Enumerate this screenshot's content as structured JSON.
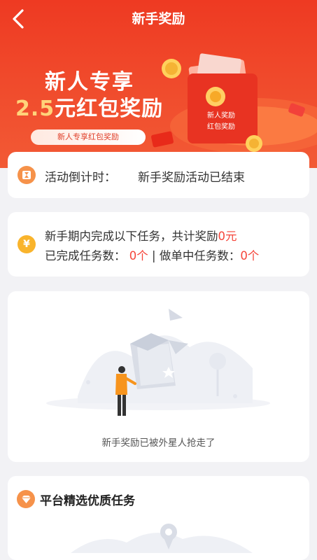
{
  "nav": {
    "title": "新手奖励",
    "back_icon": "chevron-left-icon"
  },
  "banner": {
    "line1": "新人专享",
    "amount": "2.5",
    "line2_suffix": "元红包奖励",
    "pill": "新人专享红包奖励",
    "envelope_line1": "新人奖励",
    "envelope_line2": "红包奖励",
    "colors": {
      "background": "#ee3a22",
      "accent": "#ffd37a"
    }
  },
  "countdown": {
    "label": "活动倒计时：",
    "status": "新手奖励活动已结束",
    "icon": "hourglass-icon"
  },
  "tasks": {
    "line1_prefix": "新手期内完成以下任务，共计奖励",
    "reward": "0元",
    "completed_label": "已完成任务数：",
    "completed_value": "0个",
    "separator": " | ",
    "doing_label": "做单中任务数：",
    "doing_value": "0个",
    "icon": "yen-coin-icon",
    "icon_glyph": "¥"
  },
  "empty_state": {
    "caption": "新手奖励已被外星人抢走了"
  },
  "featured": {
    "title": "平台精选优质任务",
    "icon": "diamond-icon"
  }
}
